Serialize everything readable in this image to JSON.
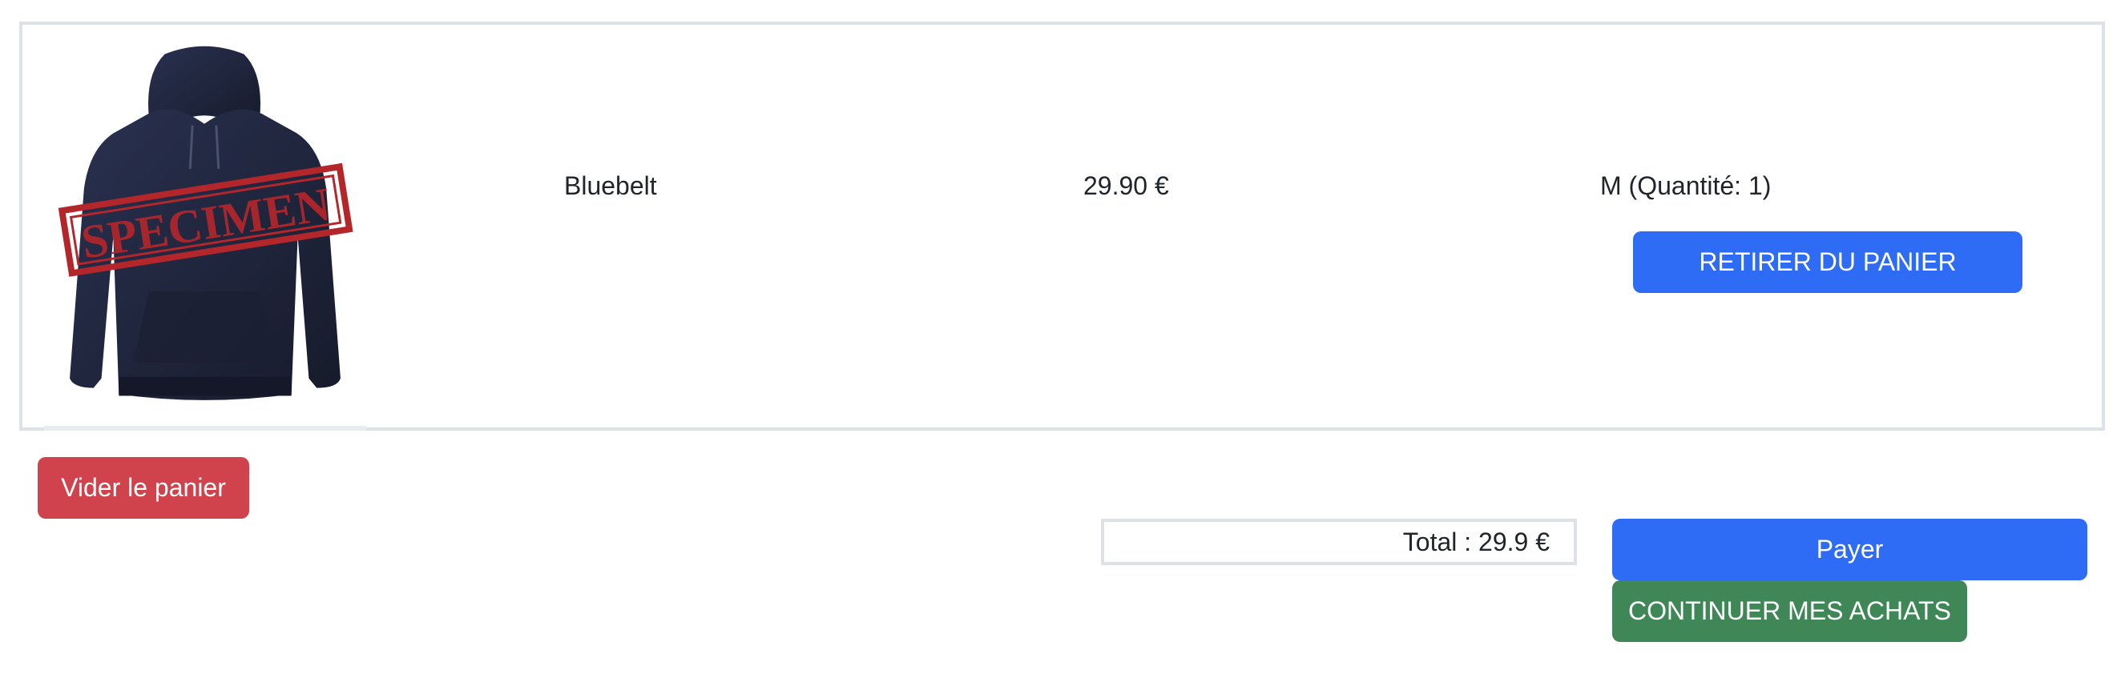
{
  "cart": {
    "items": [
      {
        "image_icon": "hoodie-product-image",
        "image_watermark": "SPECIMEN",
        "name": "Bluebelt",
        "price": "29.90 €",
        "size": "M (Quantité: 1)",
        "remove_label": "RETIRER DU PANIER"
      }
    ],
    "empty_label": "Vider le panier",
    "total": "Total : 29.9 €",
    "pay_label": "Payer",
    "continue_label": "CONTINUER MES ACHATS"
  },
  "colors": {
    "primary": "#2f6cf5",
    "danger": "#d1434c",
    "success": "#3f8757",
    "border": "#dee2e6",
    "hoodie": "#1f2538",
    "watermark": "#b3262a"
  }
}
